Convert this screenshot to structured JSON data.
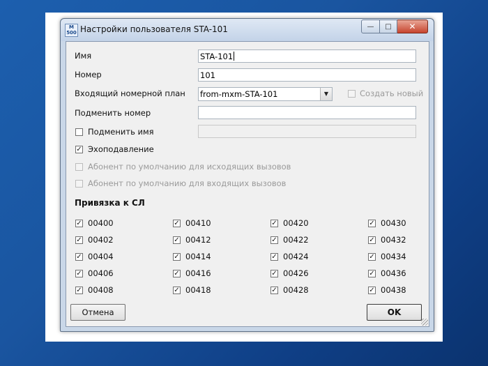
{
  "window": {
    "title": "Настройки пользователя STA-101",
    "app_icon_text": "M\n500"
  },
  "form": {
    "name_label": "Имя",
    "name_value": "STA-101",
    "number_label": "Номер",
    "number_value": "101",
    "dialplan_label": "Входящий номерной план",
    "dialplan_value": "from-mxm-STA-101",
    "create_new_label": "Создать новый",
    "replace_number_label": "Подменить номер",
    "replace_number_value": "",
    "replace_name_label": "Подменить имя",
    "replace_name_value": "",
    "echo_label": "Эхоподавление",
    "default_outgoing_label": "Абонент по умолчанию для исходящих вызовов",
    "default_incoming_label": "Абонент по умолчанию для входящих вызовов"
  },
  "trunks": {
    "title": "Привязка к СЛ",
    "columns": [
      [
        "00400",
        "00402",
        "00404",
        "00406",
        "00408"
      ],
      [
        "00410",
        "00412",
        "00414",
        "00416",
        "00418"
      ],
      [
        "00420",
        "00422",
        "00424",
        "00426",
        "00428"
      ],
      [
        "00430",
        "00432",
        "00434",
        "00436",
        "00438"
      ]
    ],
    "checked": true
  },
  "buttons": {
    "cancel": "Отмена",
    "ok": "OK"
  },
  "glyphs": {
    "check": "✓",
    "arrow": "▼",
    "min": "—",
    "max": "□",
    "close": "✕"
  }
}
